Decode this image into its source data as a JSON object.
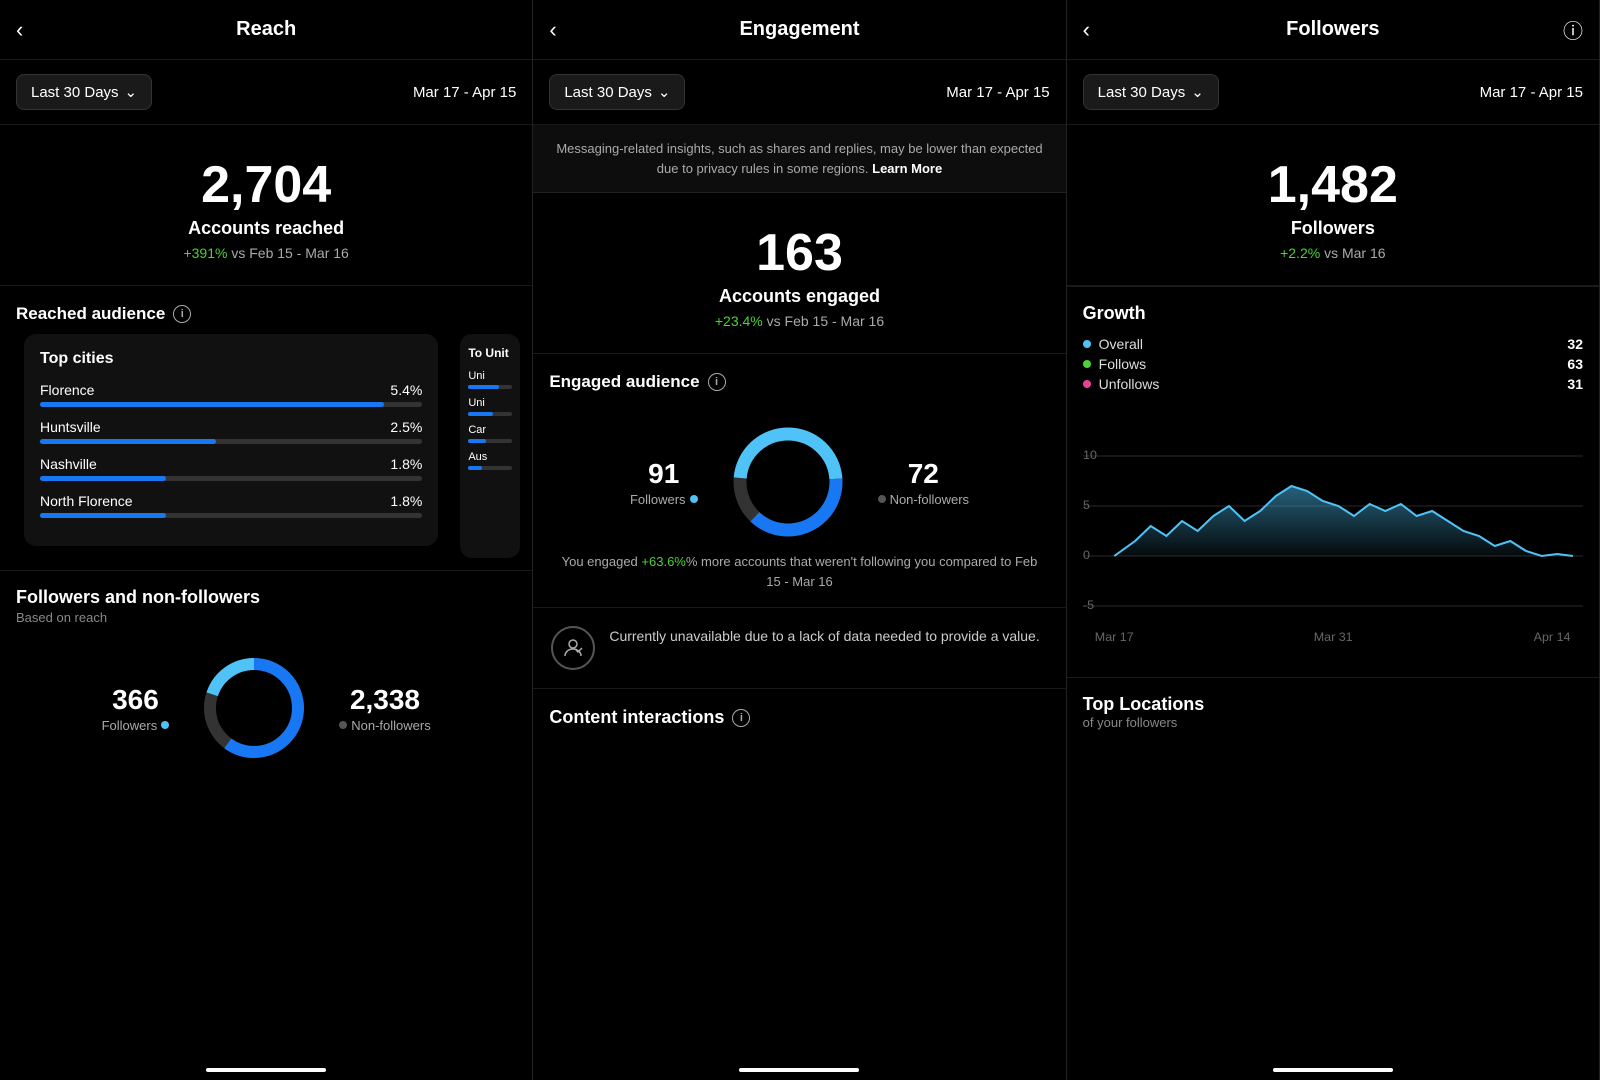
{
  "panels": [
    {
      "id": "reach",
      "title": "Reach",
      "date_dropdown": "Last 30 Days",
      "date_range": "Mar 17 - Apr 15",
      "metric_main": "2,704",
      "metric_label": "Accounts reached",
      "metric_change_pct": "+391%",
      "metric_change_rest": " vs Feb 15 - Mar 16",
      "section1_title": "Reached audience",
      "top_cities_title": "Top cities",
      "cities": [
        {
          "name": "Florence",
          "pct": "5.4%",
          "fill": 90
        },
        {
          "name": "Huntsville",
          "pct": "2.5%",
          "fill": 42
        },
        {
          "name": "Nashville",
          "pct": "1.8%",
          "fill": 30
        },
        {
          "name": "North Florence",
          "pct": "1.8%",
          "fill": 30
        }
      ],
      "top_units_title": "To Unit",
      "units": [
        {
          "name": "Uni",
          "fill": 70
        },
        {
          "name": "Uni",
          "fill": 55
        },
        {
          "name": "Car",
          "fill": 40
        },
        {
          "name": "Aus",
          "fill": 30
        }
      ],
      "fnf_title": "Followers and non-followers",
      "fnf_subtitle": "Based on reach",
      "followers_num": "366",
      "followers_label": "Followers",
      "nonfollowers_num": "2,338",
      "nonfollowers_label": "Non-followers"
    },
    {
      "id": "engagement",
      "title": "Engagement",
      "date_dropdown": "Last 30 Days",
      "date_range": "Mar 17 - Apr 15",
      "notice": "Messaging-related insights, such as shares and replies, may be lower than expected due to privacy rules in some regions.",
      "notice_link": "Learn More",
      "metric_main": "163",
      "metric_label": "Accounts engaged",
      "metric_change_pct": "+23.4%",
      "metric_change_rest": " vs Feb 15 - Mar 16",
      "engaged_audience_title": "Engaged audience",
      "followers_engaged": "91",
      "followers_label": "Followers",
      "nonfollowers_engaged": "72",
      "nonfollowers_label": "Non-followers",
      "engaged_note_pct": "+63.6%",
      "engaged_note_rest": "% more accounts that weren't following you compared to Feb 15 - Mar 16",
      "unavailable_text": "Currently unavailable due to a lack of data needed to provide a value.",
      "content_interactions_title": "Content interactions"
    },
    {
      "id": "followers",
      "title": "Followers",
      "date_dropdown": "Last 30 Days",
      "date_range": "Mar 17 - Apr 15",
      "metric_main": "1,482",
      "metric_label": "Followers",
      "metric_change_pct": "+2.2%",
      "metric_change_rest": " vs Mar 16",
      "growth_title": "Growth",
      "legend": [
        {
          "label": "Overall",
          "color": "#4fc3f7",
          "value": "32"
        },
        {
          "label": "Follows",
          "color": "#4cd137",
          "value": "63"
        },
        {
          "label": "Unfollows",
          "color": "#e84393",
          "value": "31"
        }
      ],
      "chart_y_labels": [
        "10",
        "5",
        "0",
        "-5"
      ],
      "chart_x_labels": [
        "Mar 17",
        "Mar 31",
        "Apr 14"
      ],
      "top_locations_title": "Top Locations",
      "top_locations_sub": "of your followers"
    }
  ]
}
